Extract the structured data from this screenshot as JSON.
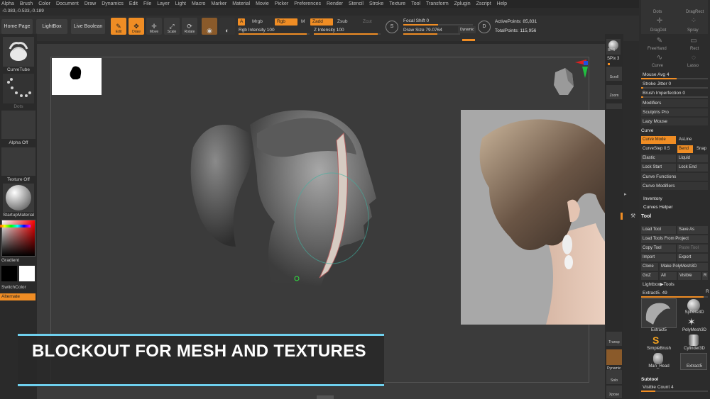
{
  "menu": [
    "Alpha",
    "Brush",
    "Color",
    "Document",
    "Draw",
    "Dynamics",
    "Edit",
    "File",
    "Layer",
    "Light",
    "Macro",
    "Marker",
    "Material",
    "Movie",
    "Picker",
    "Preferences",
    "Render",
    "Stencil",
    "Stroke",
    "Texture",
    "Tool",
    "Transform",
    "Zplugin",
    "Zscript",
    "Help"
  ],
  "coords": "-0.383,-0.533,-0.189",
  "nav": {
    "home": "Home Page",
    "lightbox": "LightBox",
    "liveboolean": "Live Boolean"
  },
  "tools": [
    {
      "label": "Edit",
      "active": true,
      "icon": "✎"
    },
    {
      "label": "Draw",
      "active": true,
      "icon": "✥"
    },
    {
      "label": "Move",
      "active": false,
      "icon": "✛"
    },
    {
      "label": "Scale",
      "active": false,
      "icon": "⤢"
    },
    {
      "label": "Rotate",
      "active": false,
      "icon": "⟳"
    }
  ],
  "draw": {
    "a": "A",
    "mrgb": "Mrgb",
    "rgb": "Rgb",
    "m": "M",
    "zadd": "Zadd",
    "zsub": "Zsub",
    "zcut": "Zcut",
    "rgb_intensity": "Rgb Intensity 100",
    "z_intensity": "Z Intensity 100",
    "focal_shift": "Focal Shift 0",
    "draw_size": "Draw Size 79.0764",
    "dynamic": "Dynamic",
    "active_points": "ActivePoints: 85,831",
    "total_points": "TotalPoints: 115,956"
  },
  "left": {
    "curvetube": "CurveTube",
    "dots": "Dots",
    "alpha_off": "Alpha Off",
    "texture_off": "Texture Off",
    "startup_material": "StartupMaterial",
    "gradient": "Gradient",
    "switch_color": "SwitchColor",
    "alternate": "Alternate"
  },
  "rtools": [
    {
      "label": "BPR"
    },
    {
      "label": "SPix 3"
    },
    {
      "label": "Scroll"
    },
    {
      "label": "Zoom"
    }
  ],
  "rtools_bottom": [
    {
      "label": "Transp"
    },
    {
      "label": "Dynamic"
    },
    {
      "label": "Solo"
    },
    {
      "label": "Xpose"
    }
  ],
  "rpanel": {
    "dots": "Dots",
    "dragrect": "DragRect",
    "spray": "Spray",
    "dragdot": "DragDot",
    "freehand": "FreeHand",
    "rect": "Rect",
    "curve": "Curve",
    "lasso": "Lasso",
    "mouse_avg": "Mouse Avg 4",
    "stroke_jitter": "Stroke Jitter 0",
    "brush_imperfection": "Brush Imperfection 0",
    "modifiers": "Modifiers",
    "sculptris_pro": "Sculptris Pro",
    "lazy_mouse": "Lazy Mouse",
    "curve_hdr": "Curve",
    "curve_mode": "Curve Mode",
    "asline": "AsLine",
    "curvestep": "CurveStep 0.5",
    "bend": "Bend",
    "snap": "Snap",
    "elastic": "Elastic",
    "liquid": "Liquid",
    "lock_start": "Lock Start",
    "lock_end": "Lock End",
    "curve_functions": "Curve Functions",
    "curve_modifiers": "Curve Modifiers",
    "inventory": "Inventory",
    "curves_helper": "Curves Helper",
    "tool_hdr": "Tool",
    "load_tool": "Load Tool",
    "save_as": "Save As",
    "load_tools_project": "Load Tools From Project",
    "copy_tool": "Copy Tool",
    "paste_tool": "Paste Tool",
    "import": "Import",
    "export": "Export",
    "clone": "Clone",
    "make_polymesh": "Make PolyMesh3D",
    "goz": "GoZ",
    "all": "All",
    "visible": "Visible",
    "r": "R",
    "lightbox_tools": "Lightbox▶Tools",
    "extract5_slider": "Extract5. 49",
    "r2": "R",
    "thumbs": [
      "Extract5",
      "Sphere3D",
      "PolyMesh3D",
      "SimpleBrush",
      "Cylinder3D",
      "Man_Head",
      "Extract5"
    ],
    "subtool": "Subtool",
    "visible_count": "Visible Count 4"
  },
  "banner": "BLOCKOUT FOR MESH AND TEXTURES",
  "colors": {
    "accent": "#f08d24",
    "banner_line": "#6fd0ee"
  }
}
